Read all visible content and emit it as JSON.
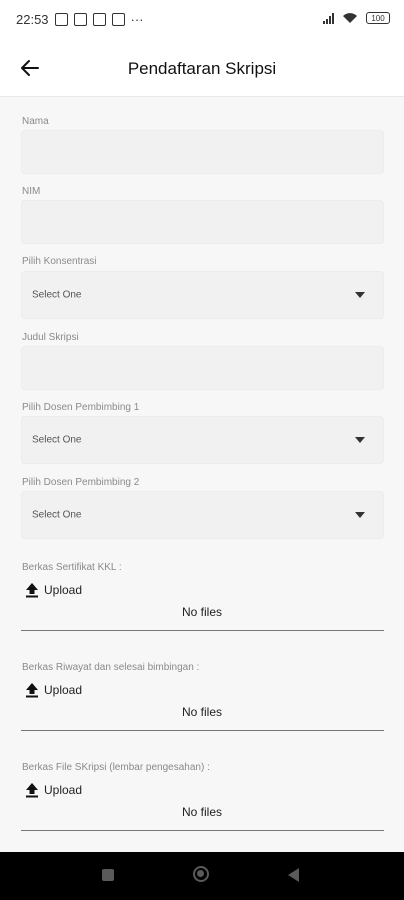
{
  "status_bar": {
    "time": "22:53",
    "more": "···",
    "battery": "100"
  },
  "app_bar": {
    "title": "Pendaftaran Skripsi"
  },
  "form": {
    "nama_label": "Nama",
    "nim_label": "NIM",
    "konsentrasi_label": "Pilih Konsentrasi",
    "konsentrasi_value": "Select One",
    "judul_label": "Judul Skripsi",
    "dosen1_label": "Pilih Dosen Pembimbing 1",
    "dosen1_value": "Select One",
    "dosen2_label": "Pilih Dosen Pembimbing 2",
    "dosen2_value": "Select One"
  },
  "uploads": {
    "kkl": {
      "label": "Berkas Sertifikat KKL :",
      "button": "Upload",
      "status": "No files"
    },
    "riwayat": {
      "label": "Berkas Riwayat dan selesai bimbingan :",
      "button": "Upload",
      "status": "No files"
    },
    "skripsi": {
      "label": "Berkas File SKripsi (lembar pengesahan) :",
      "button": "Upload",
      "status": "No files"
    }
  },
  "icons": {
    "back": "arrow-left-icon",
    "upload": "upload-icon",
    "dropdown": "caret-down-icon"
  }
}
